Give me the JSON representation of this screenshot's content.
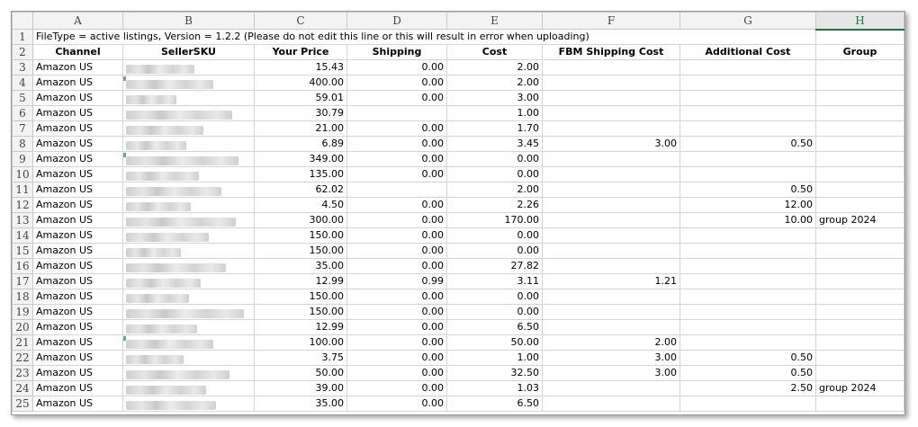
{
  "columns": [
    "A",
    "B",
    "C",
    "D",
    "E",
    "F",
    "G",
    "H"
  ],
  "selected_column": "H",
  "row_numbers": [
    "1",
    "2",
    "3",
    "4",
    "5",
    "6",
    "7",
    "8",
    "9",
    "10",
    "11",
    "12",
    "13",
    "14",
    "15",
    "16",
    "17",
    "18",
    "19",
    "20",
    "21",
    "22",
    "23",
    "24",
    "25"
  ],
  "file_info": "FileType = active listings,  Version = 1.2.2 (Please do not edit this line or this will result in error when uploading)",
  "headers": {
    "channel": "Channel",
    "sku": "SellerSKU",
    "price": "Your Price",
    "shipping": "Shipping",
    "cost": "Cost",
    "fbm": "FBM Shipping Cost",
    "additional": "Additional Cost",
    "group": "Group"
  },
  "sku_note": "SellerSKU values are pixelated/obscured in the screenshot",
  "rows": [
    {
      "channel": "Amazon US",
      "price": "15.43",
      "shipping": "0.00",
      "cost": "2.00",
      "fbm": "",
      "additional": "",
      "group": ""
    },
    {
      "channel": "Amazon US",
      "price": "400.00",
      "shipping": "0.00",
      "cost": "2.00",
      "fbm": "",
      "additional": "",
      "group": ""
    },
    {
      "channel": "Amazon US",
      "price": "59.01",
      "shipping": "0.00",
      "cost": "3.00",
      "fbm": "",
      "additional": "",
      "group": ""
    },
    {
      "channel": "Amazon US",
      "price": "30.79",
      "shipping": "",
      "cost": "1.00",
      "fbm": "",
      "additional": "",
      "group": ""
    },
    {
      "channel": "Amazon US",
      "price": "21.00",
      "shipping": "0.00",
      "cost": "1.70",
      "fbm": "",
      "additional": "",
      "group": ""
    },
    {
      "channel": "Amazon US",
      "price": "6.89",
      "shipping": "0.00",
      "cost": "3.45",
      "fbm": "3.00",
      "additional": "0.50",
      "group": ""
    },
    {
      "channel": "Amazon US",
      "price": "349.00",
      "shipping": "0.00",
      "cost": "0.00",
      "fbm": "",
      "additional": "",
      "group": ""
    },
    {
      "channel": "Amazon US",
      "price": "135.00",
      "shipping": "0.00",
      "cost": "0.00",
      "fbm": "",
      "additional": "",
      "group": ""
    },
    {
      "channel": "Amazon US",
      "price": "62.02",
      "shipping": "",
      "cost": "2.00",
      "fbm": "",
      "additional": "0.50",
      "group": ""
    },
    {
      "channel": "Amazon US",
      "price": "4.50",
      "shipping": "0.00",
      "cost": "2.26",
      "fbm": "",
      "additional": "12.00",
      "group": ""
    },
    {
      "channel": "Amazon US",
      "price": "300.00",
      "shipping": "0.00",
      "cost": "170.00",
      "fbm": "",
      "additional": "10.00",
      "group": "group 2024"
    },
    {
      "channel": "Amazon US",
      "price": "150.00",
      "shipping": "0.00",
      "cost": "0.00",
      "fbm": "",
      "additional": "",
      "group": ""
    },
    {
      "channel": "Amazon US",
      "price": "150.00",
      "shipping": "0.00",
      "cost": "0.00",
      "fbm": "",
      "additional": "",
      "group": ""
    },
    {
      "channel": "Amazon US",
      "price": "35.00",
      "shipping": "0.00",
      "cost": "27.82",
      "fbm": "",
      "additional": "",
      "group": ""
    },
    {
      "channel": "Amazon US",
      "price": "12.99",
      "shipping": "0.99",
      "cost": "3.11",
      "fbm": "1.21",
      "additional": "",
      "group": ""
    },
    {
      "channel": "Amazon US",
      "price": "150.00",
      "shipping": "0.00",
      "cost": "0.00",
      "fbm": "",
      "additional": "",
      "group": ""
    },
    {
      "channel": "Amazon US",
      "price": "150.00",
      "shipping": "0.00",
      "cost": "0.00",
      "fbm": "",
      "additional": "",
      "group": ""
    },
    {
      "channel": "Amazon US",
      "price": "12.99",
      "shipping": "0.00",
      "cost": "6.50",
      "fbm": "",
      "additional": "",
      "group": ""
    },
    {
      "channel": "Amazon US",
      "price": "100.00",
      "shipping": "0.00",
      "cost": "50.00",
      "fbm": "2.00",
      "additional": "",
      "group": ""
    },
    {
      "channel": "Amazon US",
      "price": "3.75",
      "shipping": "0.00",
      "cost": "1.00",
      "fbm": "3.00",
      "additional": "0.50",
      "group": ""
    },
    {
      "channel": "Amazon US",
      "price": "50.00",
      "shipping": "0.00",
      "cost": "32.50",
      "fbm": "3.00",
      "additional": "0.50",
      "group": ""
    },
    {
      "channel": "Amazon US",
      "price": "39.00",
      "shipping": "0.00",
      "cost": "1.03",
      "fbm": "",
      "additional": "2.50",
      "group": "group 2024"
    },
    {
      "channel": "Amazon US",
      "price": "35.00",
      "shipping": "0.00",
      "cost": "6.50",
      "fbm": "",
      "additional": "",
      "group": ""
    }
  ]
}
